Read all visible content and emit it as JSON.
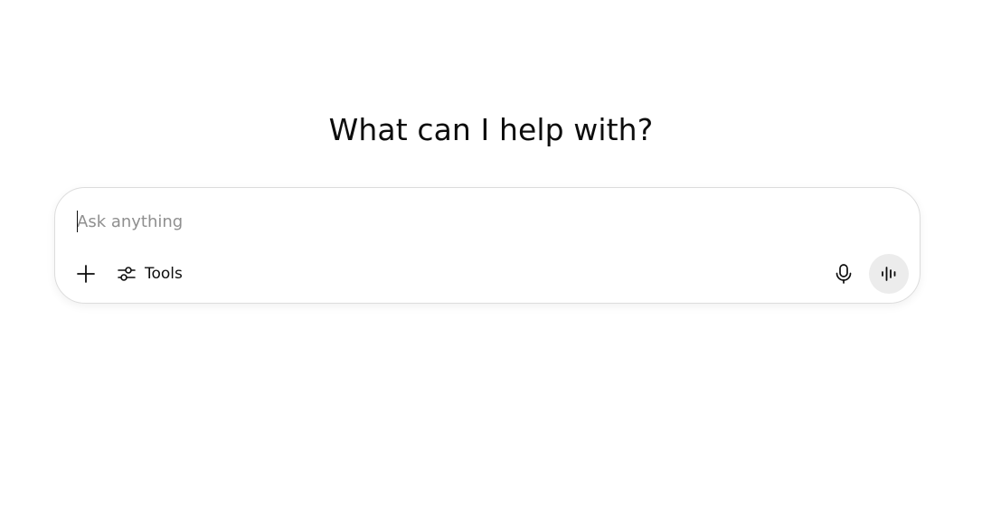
{
  "headline": "What can I help with?",
  "composer": {
    "placeholder": "Ask anything",
    "value": "",
    "tools_label": "Tools",
    "icons": {
      "add": "plus-icon",
      "tools": "sliders-icon",
      "mic": "microphone-icon",
      "voice": "voice-waveform-icon"
    }
  },
  "colors": {
    "text": "#0d0d0d",
    "placeholder": "#8f8f8f",
    "border": "#dcdcdc",
    "voice_button_bg": "#ececec"
  }
}
